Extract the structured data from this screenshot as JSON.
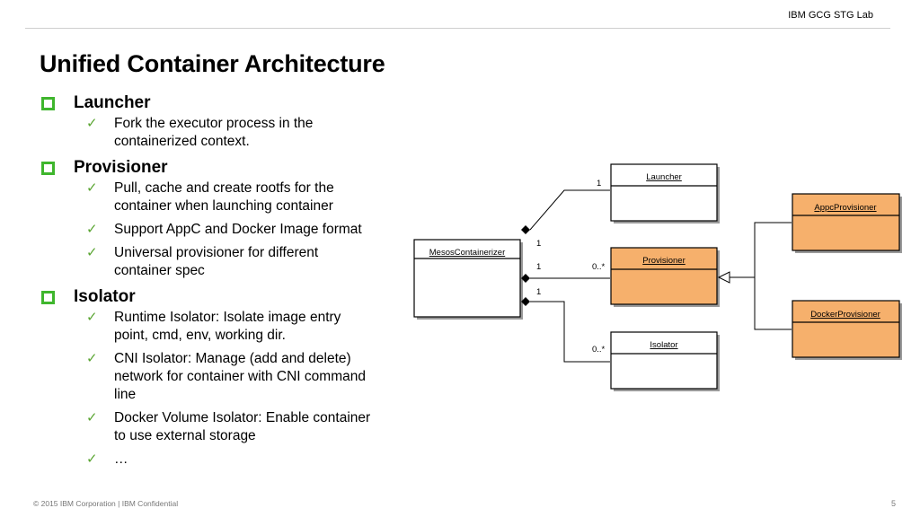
{
  "header": {
    "label": "IBM GCG STG Lab"
  },
  "title": "Unified Container Architecture",
  "sections": [
    {
      "label": "Launcher",
      "items": [
        [
          "Fork the executor process in the",
          "containerized context."
        ]
      ]
    },
    {
      "label": "Provisioner",
      "items": [
        [
          "Pull, cache and create rootfs for the",
          "container when launching container"
        ],
        [
          "Support AppC and Docker Image format"
        ],
        [
          "Universal provisioner for different",
          "container spec"
        ]
      ]
    },
    {
      "label": "Isolator",
      "items": [
        [
          "Runtime Isolator: Isolate image entry",
          "point, cmd, env, working dir."
        ],
        [
          "CNI Isolator: Manage (add and delete)",
          "network for container with CNI command",
          "line"
        ],
        [
          "Docker Volume Isolator: Enable container",
          "to use external storage"
        ],
        [
          "…"
        ]
      ]
    }
  ],
  "diagram": {
    "classes": {
      "mesos": "MesosContainerizer",
      "launcher": "Launcher",
      "provisioner": "Provisioner",
      "isolator": "Isolator",
      "appc": "AppcProvisioner",
      "docker": "DockerProvisioner"
    },
    "multiplicities": {
      "launcher_end": "1",
      "mesos_top": "1",
      "mesos_mid": "1",
      "provisioner_end": "0..*",
      "mesos_bottom": "1",
      "isolator_end": "0..*"
    },
    "colors": {
      "highlight": "#f6b06c",
      "shadow": "#9a9a9a"
    }
  },
  "footer": {
    "copyright": "© 2015 IBM Corporation | IBM Confidential",
    "page": "5"
  }
}
